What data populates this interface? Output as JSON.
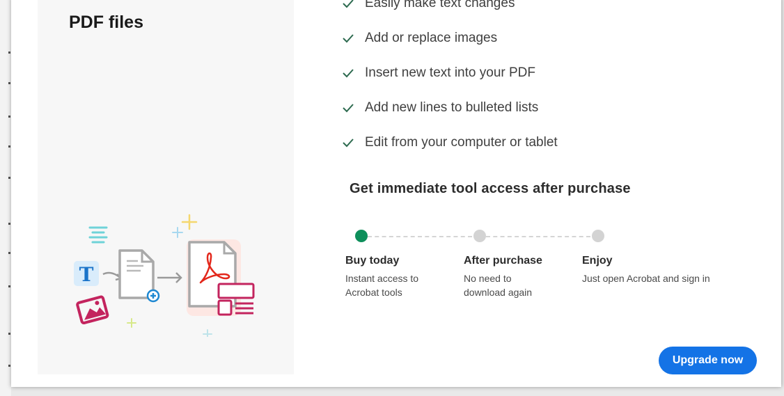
{
  "panel": {
    "heading_line2": "PDF files"
  },
  "features": [
    {
      "label": "Easily make text changes",
      "icon": "check-icon"
    },
    {
      "label": "Add or replace images",
      "icon": "check-icon"
    },
    {
      "label": "Insert new text into your PDF",
      "icon": "check-icon"
    },
    {
      "label": "Add new lines to bulleted lists",
      "icon": "check-icon"
    },
    {
      "label": "Edit from your computer or tablet",
      "icon": "check-icon"
    }
  ],
  "access": {
    "title": "Get immediate tool access after purchase",
    "steps": [
      {
        "title": "Buy today",
        "desc_line1": "Instant access to",
        "desc_line2": "Acrobat tools",
        "status": "current"
      },
      {
        "title": "After purchase",
        "desc_line1": "No need to",
        "desc_line2": "download again",
        "status": "upcoming"
      },
      {
        "title": "Enjoy",
        "desc_line1": "Just open Acrobat and sign in",
        "desc_line2": "",
        "status": "upcoming"
      }
    ]
  },
  "cta": {
    "upgrade_label": "Upgrade now"
  },
  "colors": {
    "accent": "#1473e6",
    "check": "#2d6a4f",
    "step_active": "#0e8f5b",
    "step_inactive": "#d3d3d3",
    "acrobat_red": "#e3271b"
  }
}
